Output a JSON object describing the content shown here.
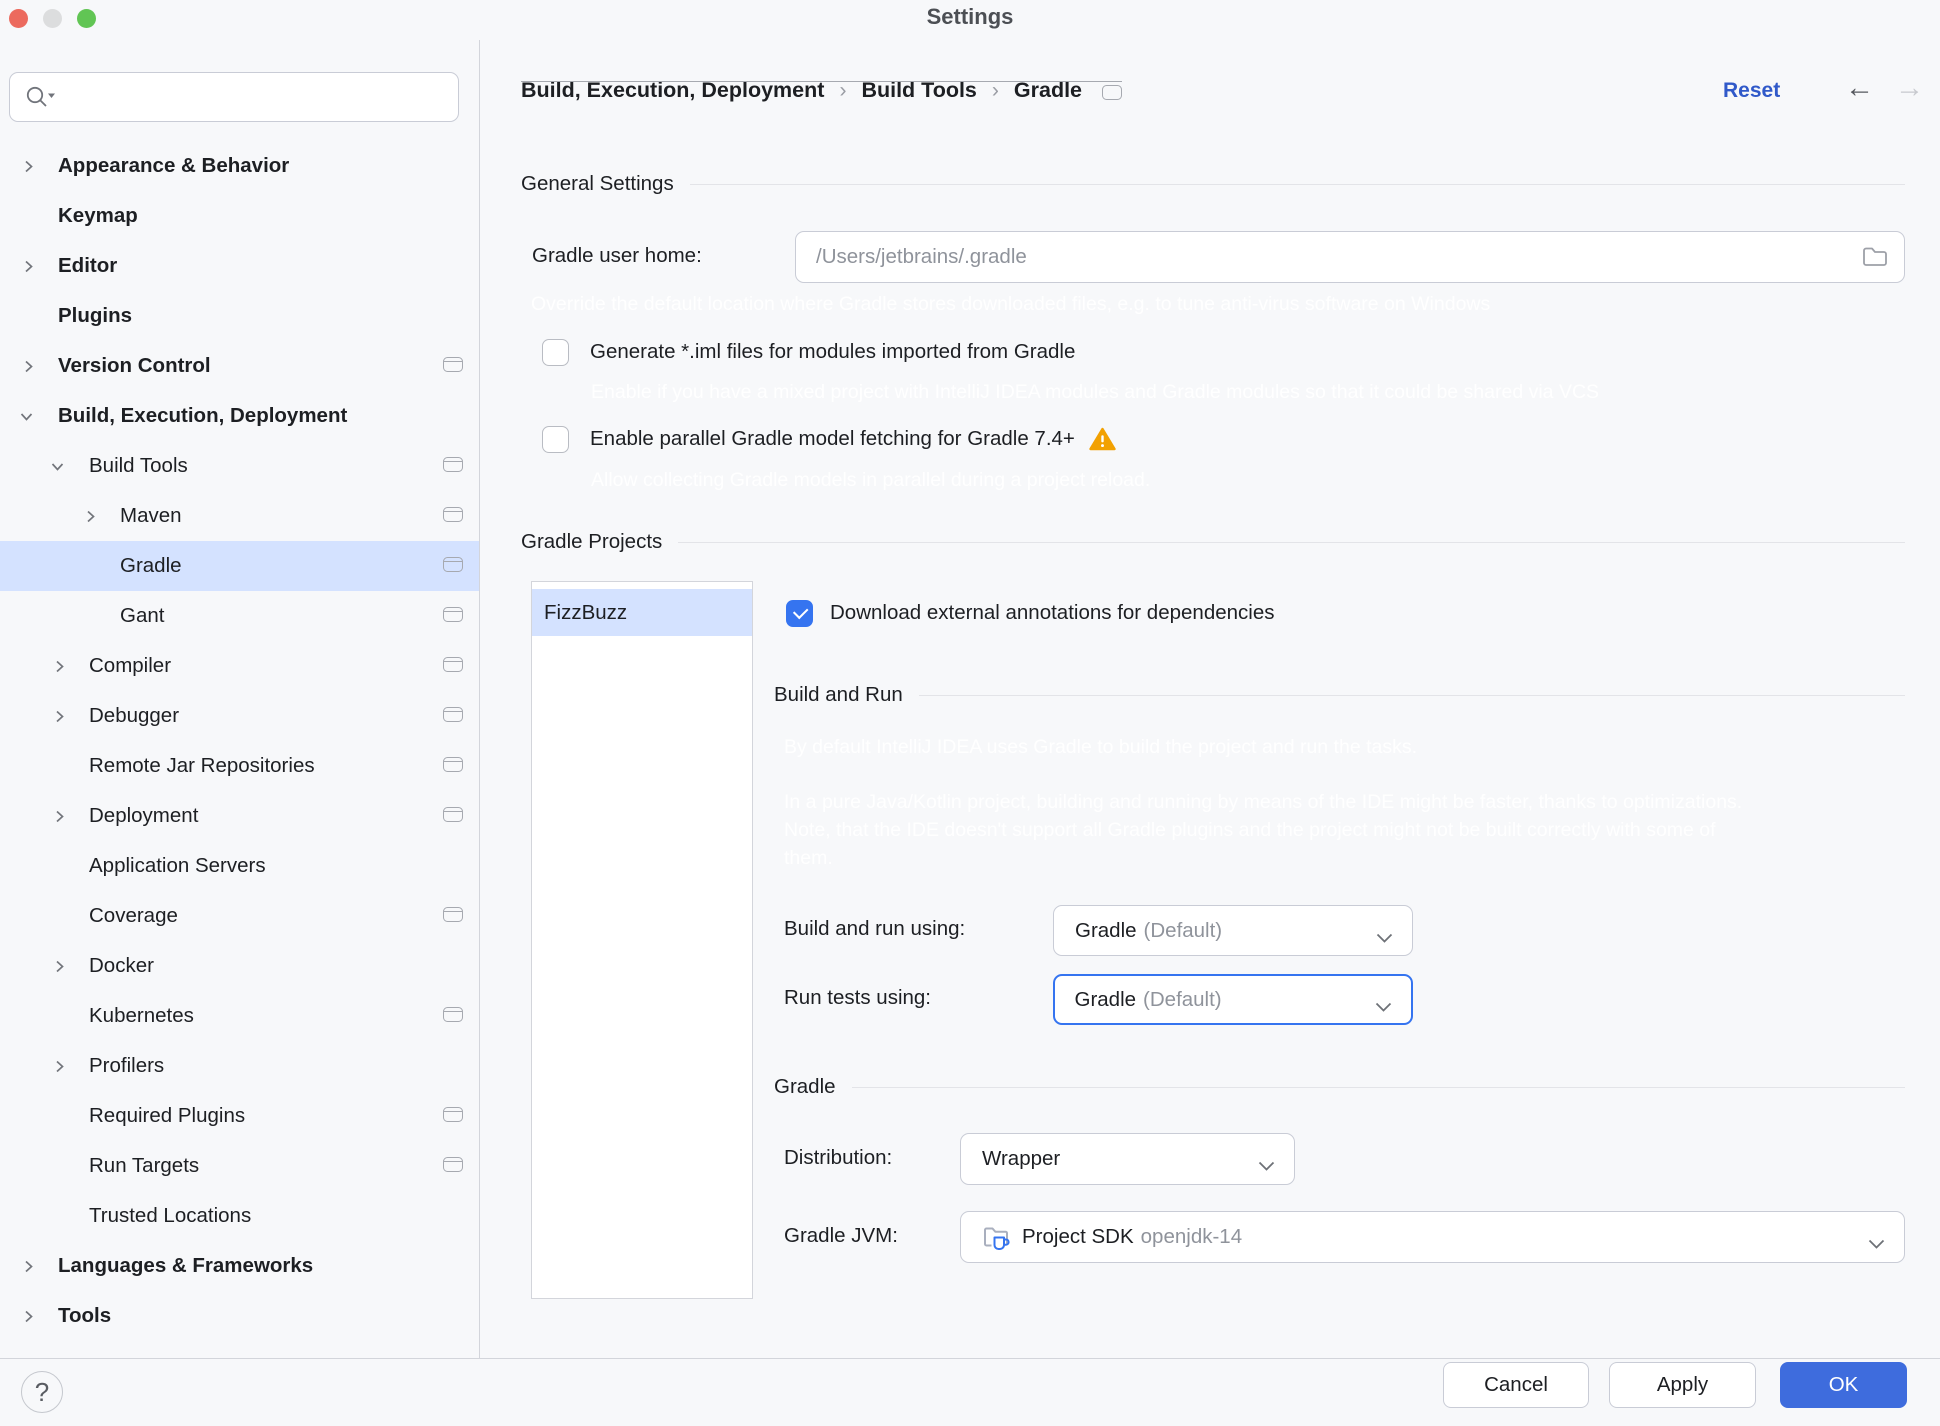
{
  "window": {
    "title": "Settings"
  },
  "sidebar": {
    "search_placeholder": "",
    "items": [
      {
        "label": "Appearance & Behavior",
        "indent": 1,
        "bold": true,
        "chevron": "right",
        "icon": false,
        "selected": false
      },
      {
        "label": "Keymap",
        "indent": 1,
        "bold": true,
        "chevron": null,
        "icon": false,
        "selected": false
      },
      {
        "label": "Editor",
        "indent": 1,
        "bold": true,
        "chevron": "right",
        "icon": false,
        "selected": false
      },
      {
        "label": "Plugins",
        "indent": 1,
        "bold": true,
        "chevron": null,
        "icon": false,
        "selected": false
      },
      {
        "label": "Version Control",
        "indent": 1,
        "bold": true,
        "chevron": "right",
        "icon": true,
        "selected": false
      },
      {
        "label": "Build, Execution, Deployment",
        "indent": 1,
        "bold": true,
        "chevron": "down",
        "icon": false,
        "selected": false
      },
      {
        "label": "Build Tools",
        "indent": 2,
        "bold": false,
        "chevron": "down",
        "icon": true,
        "selected": false
      },
      {
        "label": "Maven",
        "indent": 3,
        "bold": false,
        "chevron": "right",
        "icon": true,
        "selected": false
      },
      {
        "label": "Gradle",
        "indent": 3,
        "bold": false,
        "chevron": null,
        "icon": true,
        "selected": true
      },
      {
        "label": "Gant",
        "indent": 3,
        "bold": false,
        "chevron": null,
        "icon": true,
        "selected": false
      },
      {
        "label": "Compiler",
        "indent": 2,
        "bold": false,
        "chevron": "right",
        "icon": true,
        "selected": false
      },
      {
        "label": "Debugger",
        "indent": 2,
        "bold": false,
        "chevron": "right",
        "icon": true,
        "selected": false
      },
      {
        "label": "Remote Jar Repositories",
        "indent": 2,
        "bold": false,
        "chevron": null,
        "icon": true,
        "selected": false
      },
      {
        "label": "Deployment",
        "indent": 2,
        "bold": false,
        "chevron": "right",
        "icon": true,
        "selected": false
      },
      {
        "label": "Application Servers",
        "indent": 2,
        "bold": false,
        "chevron": null,
        "icon": false,
        "selected": false
      },
      {
        "label": "Coverage",
        "indent": 2,
        "bold": false,
        "chevron": null,
        "icon": true,
        "selected": false
      },
      {
        "label": "Docker",
        "indent": 2,
        "bold": false,
        "chevron": "right",
        "icon": false,
        "selected": false
      },
      {
        "label": "Kubernetes",
        "indent": 2,
        "bold": false,
        "chevron": null,
        "icon": true,
        "selected": false
      },
      {
        "label": "Profilers",
        "indent": 2,
        "bold": false,
        "chevron": "right",
        "icon": false,
        "selected": false
      },
      {
        "label": "Required Plugins",
        "indent": 2,
        "bold": false,
        "chevron": null,
        "icon": true,
        "selected": false
      },
      {
        "label": "Run Targets",
        "indent": 2,
        "bold": false,
        "chevron": null,
        "icon": true,
        "selected": false
      },
      {
        "label": "Trusted Locations",
        "indent": 2,
        "bold": false,
        "chevron": null,
        "icon": false,
        "selected": false
      },
      {
        "label": "Languages & Frameworks",
        "indent": 1,
        "bold": true,
        "chevron": "right",
        "icon": false,
        "selected": false
      },
      {
        "label": "Tools",
        "indent": 1,
        "bold": true,
        "chevron": "right",
        "icon": false,
        "selected": false
      }
    ]
  },
  "header": {
    "breadcrumb": [
      "Build, Execution, Deployment",
      "Build Tools",
      "Gradle"
    ],
    "reset_label": "Reset",
    "back_arrow": "←",
    "forward_arrow": "→"
  },
  "general_settings": {
    "title": "General Settings",
    "gradle_user_home_label": "Gradle user home:",
    "gradle_user_home_value": "",
    "gradle_user_home_placeholder": "/Users/jetbrains/.gradle",
    "gradle_user_home_hint": "Override the default location where Gradle stores downloaded files, e.g. to tune anti-virus software on Windows",
    "generate_iml_label": "Generate *.iml files for modules imported from Gradle",
    "generate_iml_checked": false,
    "generate_iml_hint": "Enable if you have a mixed project with IntelliJ IDEA modules and Gradle modules so that it could be shared via VCS",
    "parallel_fetch_label": "Enable parallel Gradle model fetching for Gradle 7.4+",
    "parallel_fetch_checked": false,
    "parallel_fetch_hint": "Allow collecting Gradle models in parallel during a project reload."
  },
  "gradle_projects": {
    "title": "Gradle Projects",
    "projects": [
      "FizzBuzz"
    ],
    "selected_project": "FizzBuzz",
    "download_annotations_label": "Download external annotations for dependencies",
    "download_annotations_checked": true,
    "build_and_run": {
      "title": "Build and Run",
      "hint1": "By default IntelliJ IDEA uses Gradle to build the project and run the tasks.",
      "hint2": "In a pure Java/Kotlin project, building and running by means of the IDE might be faster, thanks to optimizations. Note, that the IDE doesn't support all Gradle plugins and the project might not be built correctly with some of them.",
      "build_run_label": "Build and run using:",
      "build_run_value": "Gradle",
      "build_run_suffix": "(Default)",
      "run_tests_label": "Run tests using:",
      "run_tests_value": "Gradle",
      "run_tests_suffix": "(Default)"
    },
    "gradle_section": {
      "title": "Gradle",
      "distribution_label": "Distribution:",
      "distribution_value": "Wrapper",
      "jvm_label": "Gradle JVM:",
      "jvm_value": "Project SDK",
      "jvm_version": "openjdk-14"
    }
  },
  "footer": {
    "cancel": "Cancel",
    "apply": "Apply",
    "ok": "OK",
    "help": "?"
  },
  "colors": {
    "accent": "#3574F0",
    "selection": "#D4E2FF",
    "link_blue": "#3059C9",
    "ok_button": "#3E6CDD",
    "warning": "#F2A102",
    "background": "#F7F8FA"
  }
}
